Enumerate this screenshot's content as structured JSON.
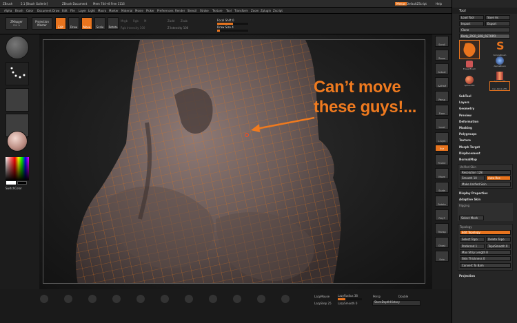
{
  "titlebar": {
    "items": [
      "ZBrush",
      "5.1 [Brush Gallerie]",
      "ZBrush Document",
      "Mem 744+8 Free 1116"
    ],
    "right": [
      "Menus",
      "DefaultZScript",
      "Help"
    ]
  },
  "menubar": {
    "items": [
      "Alpha",
      "Brush",
      "Color",
      "Document",
      "Draw",
      "Edit",
      "File",
      "Layer",
      "Light",
      "Macro",
      "Marker",
      "Material",
      "Movie",
      "Picker",
      "Preferences",
      "Render",
      "Stencil",
      "Stroke",
      "Texture",
      "Tool",
      "Transform",
      "Zoom",
      "Zplugin",
      "Zscript"
    ]
  },
  "topshelf": {
    "zmapper": "ZMapper",
    "zmapper_sub": "rev E",
    "projection": "Projection",
    "projection_sub": "Master",
    "edit": "Edit",
    "draw": "Draw",
    "move": "Move",
    "scale": "Scale",
    "rotate": "Rotate",
    "focal_label": "Focal Shift 0",
    "drawsize_label": "Draw Size 4",
    "zadd_label": "Zadd",
    "zsub_label": "Zsub",
    "rgb_intensity": "Rgb Intensity 100",
    "z_intensity": "Z Intensity 100",
    "mrgb": "Mrgb",
    "rgb": "Rgb",
    "m": "M"
  },
  "left": {
    "switch_color": "SwitchColor"
  },
  "annotation": {
    "line1": "Can’t move",
    "line2": "these guys!..."
  },
  "right_icons": [
    "Scroll",
    "Zoom",
    "Actual",
    "AAHalf",
    "Persp",
    "Floor",
    "Local",
    "L.Sym",
    "Xyz",
    "Frame",
    "Move",
    "Scale",
    "Rotate",
    "PolyF",
    "Transp",
    "Ghost",
    "Solo"
  ],
  "bottom": {
    "lazymouse": "LazyMouse",
    "lazyradius": "LazyRadius 38",
    "lazystep": "LazyStep 25",
    "lazysmooth": "LazySmooth 0",
    "persp": "Persp",
    "double": "Double",
    "stored_history": "StoreDepthHistory"
  },
  "tray": {
    "title": "Tool",
    "load_tool": "Load Tool",
    "save_as": "Save As",
    "import": "Import",
    "export": "Export",
    "clone": "Clone",
    "current_tool": "Body_ZIGR_SRB_RETOPO",
    "thumbs": [
      "SimpleBrush",
      "AlphaBrush",
      "EraserBrush",
      "Sphere3D",
      "Cylinder3D",
      "Car_block_ZTL"
    ],
    "sections": [
      "SubTool",
      "Layers",
      "Geometry",
      "Preview",
      "Deformation",
      "Masking",
      "Polygroups",
      "Texture",
      "Morph Target",
      "Displacement",
      "NormalMap"
    ],
    "unified_skin": "Unified Skin",
    "resolution": "Resolution 128",
    "smooth": "Smooth 10",
    "smooth_val": "10",
    "auto_res": "Auto Res",
    "make_unified": "Make Unified Skin",
    "display_props": "Display Properties",
    "adaptive_skin": "Adaptive Skin",
    "rigging": "Rigging",
    "select_mesh": "Select Mesh",
    "topology": "Topology",
    "edit_topology": "Edit Topology",
    "select_topo": "Select Topo",
    "delete_topo": "Delete Topo",
    "preferred": "Preferred 1",
    "topo_smooth": "TopoSmooth 0",
    "max_strip": "Max Strip Length 8",
    "skin_thickness": "Skin Thickness 0",
    "convert": "Convert To Bam",
    "projection": "Projection"
  }
}
